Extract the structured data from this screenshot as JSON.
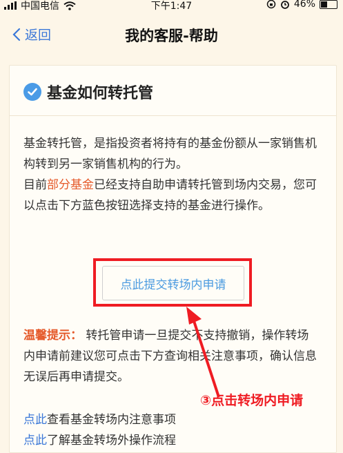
{
  "status_bar": {
    "carrier": "中国电信",
    "time": "下午1:47",
    "battery_percent": "46%",
    "battery_level": 0.46
  },
  "nav": {
    "back_label": "返回",
    "title": "我的客服-帮助"
  },
  "article": {
    "heading": "基金如何转托管",
    "para1": "基金转托管，是指投资者将持有的基金份额从一家销售机构转到另一家销售机构的行为。",
    "para2_before": "目前",
    "para2_highlight": "部分基金",
    "para2_after": "已经支持自助申请转托管到场内交易，您可以点击下方蓝色按钮选择支持的基金进行操作。",
    "apply_button": "点此提交转场内申请",
    "tip_label": "温馨提示：",
    "tip_text": " 转托管申请一旦提交不支持撤销，操作转场内申请前建议您可点击下方查询相关注意事项，确认信息无误后再申请提交。",
    "link1_label": "点此",
    "link1_text": "查看基金转场内注意事项",
    "link2_label": "点此",
    "link2_text": "了解基金转场外操作流程"
  },
  "annotation": {
    "text": "③点击转场内申请",
    "color": "#ef1c23"
  },
  "colors": {
    "accent_blue": "#3b78d8",
    "highlight_orange": "#e55a2b"
  }
}
